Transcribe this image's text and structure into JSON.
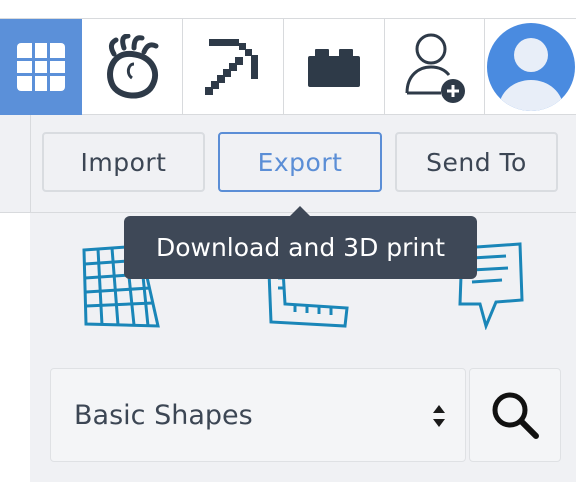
{
  "topbar": {
    "items": [
      {
        "name": "grid-view",
        "icon": "grid-icon"
      },
      {
        "name": "creatures",
        "icon": "bird-egg-icon"
      },
      {
        "name": "minecraft",
        "icon": "pickaxe-icon"
      },
      {
        "name": "lego",
        "icon": "lego-brick-icon"
      },
      {
        "name": "collaborate",
        "icon": "add-user-icon"
      },
      {
        "name": "profile",
        "icon": "avatar-icon"
      }
    ],
    "active_color": "#5b90d9"
  },
  "toolbar": {
    "import_label": "Import",
    "export_label": "Export",
    "send_to_label": "Send To"
  },
  "tooltip": {
    "text": "Download and 3D print"
  },
  "shapes_panel": {
    "tool_icons": [
      "workplane-icon",
      "ruler-icon",
      "notes-icon"
    ],
    "select_value": "Basic Shapes",
    "accent": "#1a86b8"
  }
}
